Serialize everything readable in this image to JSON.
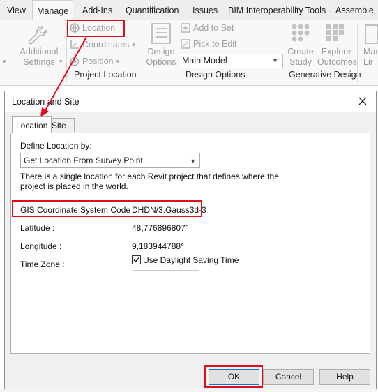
{
  "ribbon": {
    "tabs": [
      "View",
      "Manage",
      "Add-Ins",
      "Quantification",
      "Issues",
      "BIM Interoperability Tools",
      "Assemble"
    ],
    "active_tab": "Manage",
    "additional_settings": [
      "Additional",
      "Settings"
    ],
    "location_label": "Location",
    "coordinates_label": "Coordinates",
    "position_label": "Position",
    "project_location_title": "Project Location",
    "design_options": [
      "Design",
      "Options"
    ],
    "add_to_set_label": "Add to Set",
    "pick_to_edit_label": "Pick to Edit",
    "main_model_value": "Main Model",
    "design_options_title": "Design Options",
    "create_study": [
      "Create",
      "Study"
    ],
    "explore_outcomes": [
      "Explore",
      "Outcomes"
    ],
    "generative_design_title": "Generative Design",
    "cut_label": [
      "Mar",
      "Lir"
    ]
  },
  "dialog": {
    "title": "Location and Site",
    "tabs": [
      "Location",
      "Site"
    ],
    "define_location_label": "Define Location by:",
    "define_location_value": "Get Location From Survey Point",
    "description": [
      "There is a single location for each Revit project that defines where the",
      "project is placed in the world."
    ],
    "gis_label": "GIS Coordinate System Code :",
    "gis_value": "DHDN/3.Gauss3d-3",
    "latitude_label": "Latitude :",
    "latitude_value": "48,776896807°",
    "longitude_label": "Longitude :",
    "longitude_value": "9,183944788°",
    "timezone_label": "Time Zone :",
    "daylight_saving_label": "Use Daylight Saving Time",
    "daylight_saving_checked": true,
    "buttons": {
      "ok": "OK",
      "cancel": "Cancel",
      "help": "Help"
    }
  },
  "colors": {
    "annotation_red": "#e10d1a",
    "default_button_border": "#0078d7"
  }
}
